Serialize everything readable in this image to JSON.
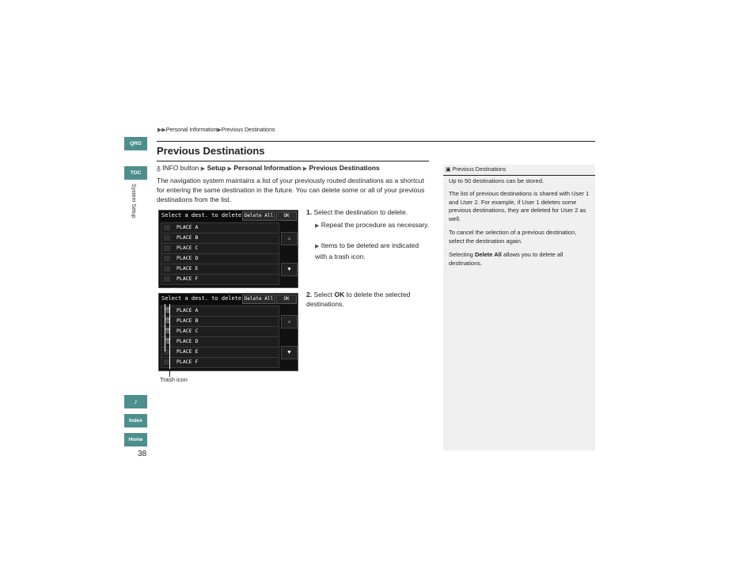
{
  "side_tabs": {
    "qrg": "QRG",
    "toc": "TOC",
    "voice": "",
    "index": "Index",
    "home": "Home"
  },
  "side_label": "System Setup",
  "page_number": "38",
  "breadcrumb": {
    "item1": "Personal Information",
    "item2": "Previous Destinations"
  },
  "title": "Previous Destinations",
  "path": {
    "start": "INFO button",
    "p1": "Setup",
    "p2": "Personal Information",
    "p3": "Previous Destinations"
  },
  "intro": "The navigation system maintains a list of your previously routed destinations as a shortcut for entering the same destination in the future. You can delete some or all of your previous destinations from the list.",
  "screen": {
    "title": "Select a dest. to delete",
    "delete_all": "Delete All",
    "ok": "OK",
    "places": [
      "PLACE A",
      "PLACE B",
      "PLACE C",
      "PLACE D",
      "PLACE E",
      "PLACE F"
    ]
  },
  "steps": {
    "s1_num": "1.",
    "s1_text": "Select the destination to delete.",
    "s1_sub1": "Repeat the procedure as necessary.",
    "s1_sub2": "Items to be deleted are indicated with a trash icon.",
    "s2_num": "2.",
    "s2_pre": "Select",
    "s2_ok": "OK",
    "s2_post": "to delete the selected destinations."
  },
  "caption": "Trash icon",
  "note": {
    "head": "Previous Destinations",
    "p1": "Up to 50 destinations can be stored.",
    "p2": "The list of previous destinations is shared with User 1 and User 2. For example, if User 1 deletes some previous destinations, they are deleted for User 2 as well.",
    "p3": "To cancel the selection of a previous destination, select the destination again.",
    "p4_pre": "Selecting",
    "p4_bold": "Delete All",
    "p4_post": "allows you to delete all destinations."
  }
}
